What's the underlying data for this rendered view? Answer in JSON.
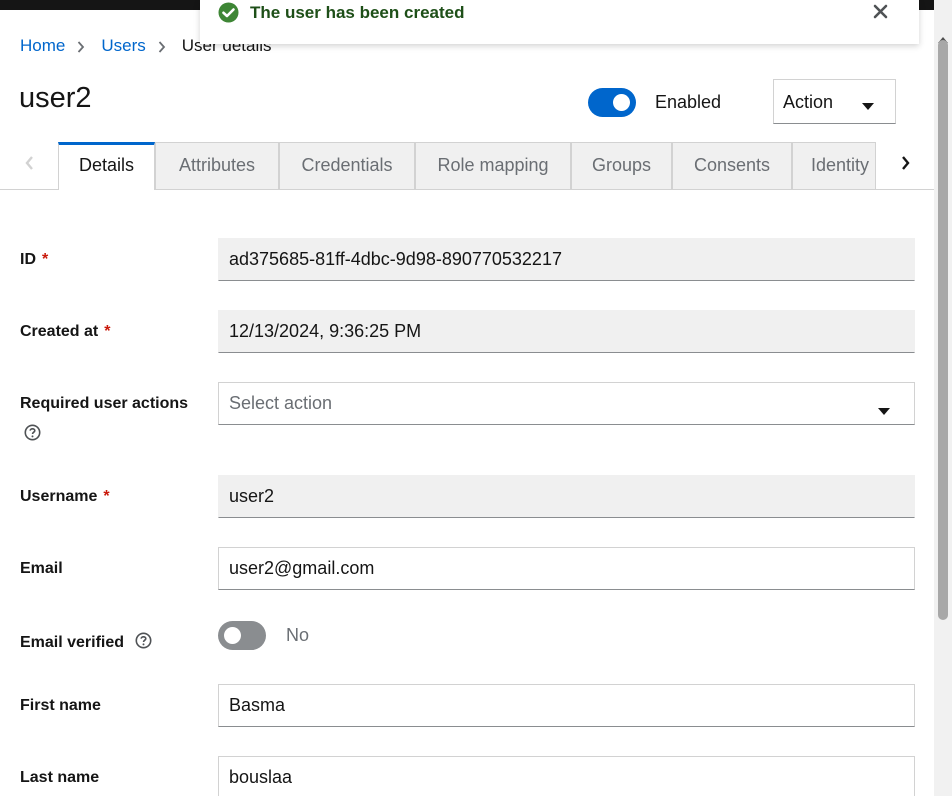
{
  "alert": {
    "message": "The user has been created",
    "close_icon": "close-icon"
  },
  "breadcrumb": {
    "home": "Home",
    "users": "Users",
    "current": "User details"
  },
  "header": {
    "title": "user2",
    "enabled_label": "Enabled",
    "enabled": true,
    "action_label": "Action"
  },
  "tabs": [
    {
      "label": "Details",
      "active": true
    },
    {
      "label": "Attributes"
    },
    {
      "label": "Credentials"
    },
    {
      "label": "Role mapping"
    },
    {
      "label": "Groups"
    },
    {
      "label": "Consents"
    },
    {
      "label": "Identity"
    }
  ],
  "form": {
    "id": {
      "label": "ID",
      "value": "ad375685-81ff-4dbc-9d98-890770532217"
    },
    "created_at": {
      "label": "Created at",
      "value": "12/13/2024, 9:36:25 PM"
    },
    "required_actions": {
      "label": "Required user actions",
      "placeholder": "Select action"
    },
    "username": {
      "label": "Username",
      "value": "user2"
    },
    "email": {
      "label": "Email",
      "value": "user2@gmail.com"
    },
    "email_verified": {
      "label": "Email verified",
      "value_label": "No",
      "checked": false
    },
    "first_name": {
      "label": "First name",
      "value": "Basma"
    },
    "last_name": {
      "label": "Last name",
      "value": "bouslaa"
    }
  },
  "colors": {
    "accent": "#0066cc",
    "success": "#3e8635",
    "required": "#c9190b"
  }
}
